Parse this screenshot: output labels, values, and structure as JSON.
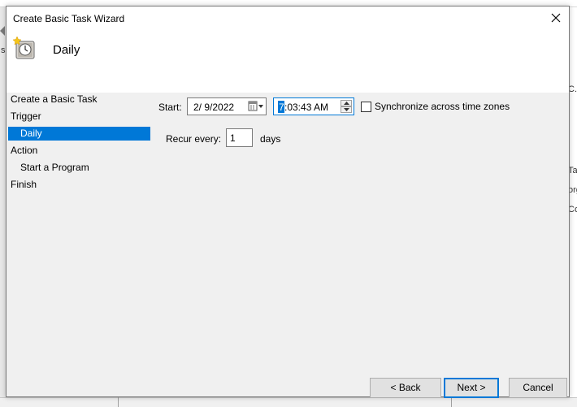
{
  "background": {
    "left_text": "s",
    "right_texts": [
      "C.",
      "Ta",
      "org",
      "Co"
    ]
  },
  "window": {
    "title": "Create Basic Task Wizard",
    "close_label": "Close"
  },
  "header": {
    "title": "Daily",
    "icon": "task-clock-icon"
  },
  "nav": {
    "items": [
      {
        "label": "Create a Basic Task",
        "indent": false,
        "selected": false
      },
      {
        "label": "Trigger",
        "indent": false,
        "selected": false
      },
      {
        "label": "Daily",
        "indent": true,
        "selected": true
      },
      {
        "label": "Action",
        "indent": false,
        "selected": false
      },
      {
        "label": "Start a Program",
        "indent": true,
        "selected": false
      },
      {
        "label": "Finish",
        "indent": false,
        "selected": false
      }
    ]
  },
  "form": {
    "start_label": "Start:",
    "date_value": "2/  9/2022",
    "time_selected": "7",
    "time_rest": ":03:43 AM",
    "sync_label": "Synchronize across time zones",
    "sync_checked": false,
    "recur_label": "Recur every:",
    "recur_value": "1",
    "recur_unit": "days"
  },
  "buttons": {
    "back": "< Back",
    "next": "Next >",
    "cancel": "Cancel"
  },
  "colors": {
    "accent": "#0078d7",
    "dialog_bg": "#f0f0f0",
    "header_bg": "#ffffff"
  }
}
